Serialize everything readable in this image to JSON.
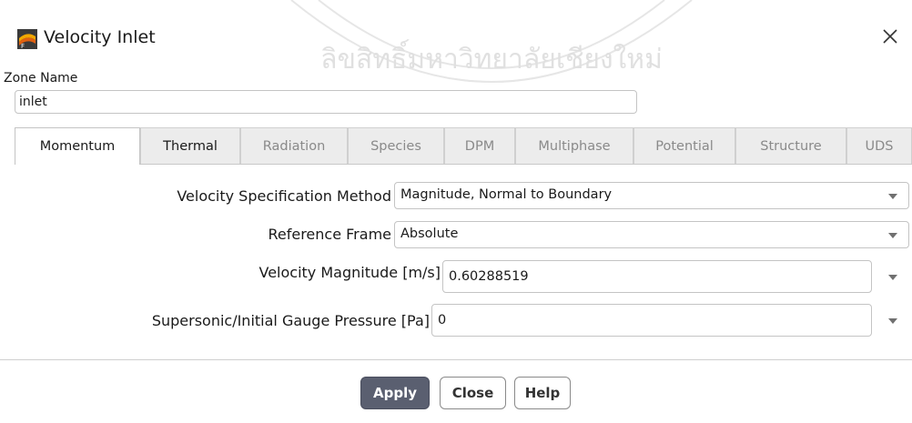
{
  "window": {
    "title": "Velocity Inlet",
    "icon": "fluent-app-icon",
    "close_icon": "close-icon"
  },
  "zone": {
    "label": "Zone Name",
    "value": "inlet"
  },
  "tabs": [
    {
      "label": "Momentum",
      "state": "active"
    },
    {
      "label": "Thermal",
      "state": "enabled"
    },
    {
      "label": "Radiation",
      "state": "disabled"
    },
    {
      "label": "Species",
      "state": "disabled"
    },
    {
      "label": "DPM",
      "state": "disabled"
    },
    {
      "label": "Multiphase",
      "state": "disabled"
    },
    {
      "label": "Potential",
      "state": "disabled"
    },
    {
      "label": "Structure",
      "state": "disabled"
    },
    {
      "label": "UDS",
      "state": "disabled"
    }
  ],
  "momentum": {
    "velocity_method": {
      "label": "Velocity Specification Method",
      "value": "Magnitude, Normal to Boundary"
    },
    "reference_frame": {
      "label": "Reference Frame",
      "value": "Absolute"
    },
    "velocity_magnitude": {
      "label": "Velocity Magnitude [m/s]",
      "value": "0.60288519"
    },
    "gauge_pressure": {
      "label": "Supersonic/Initial Gauge Pressure [Pa]",
      "value": "0"
    }
  },
  "buttons": {
    "apply": "Apply",
    "close": "Close",
    "help": "Help"
  },
  "watermark": "ลิขสิทธิ์มหาวิทยาลัยเชียงใหม่",
  "colors": {
    "primary_button": "#5a5f70",
    "tab_inactive": "#ececec"
  }
}
